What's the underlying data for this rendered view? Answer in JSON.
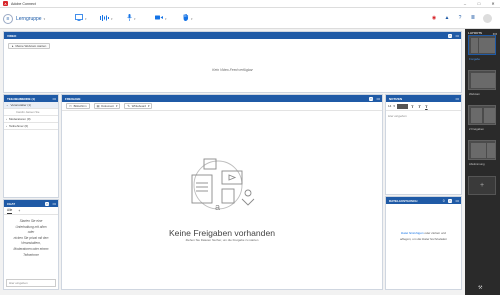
{
  "window": {
    "title": "Adobe Connect",
    "logo": "A"
  },
  "toolbar": {
    "room_name": "Lerngruppe",
    "share_icon": "share-screen-icon",
    "audio_icon": "audio-bars-icon",
    "mic_icon": "microphone-icon",
    "camera_icon": "camera-icon",
    "hand_icon": "raise-hand-icon"
  },
  "video": {
    "header": "VIDEO",
    "start_button": "Meine Webcam starten",
    "empty_text": "Kein Video-Feed verfügbar"
  },
  "participants": {
    "header": "TEILNEHMENDE (1)",
    "rows": [
      {
        "label": "Veranstalter (1)",
        "selected": true
      },
      {
        "label": "Carolin Jansen  Sie",
        "type": "name"
      },
      {
        "label": "Moderatoren (0)"
      },
      {
        "label": "Teilnehmer (0)"
      }
    ]
  },
  "share": {
    "header": "FREIGABE",
    "buttons": [
      "Bildschirm",
      "Dokument",
      "Whiteboard"
    ],
    "title": "Keine Freigaben vorhanden",
    "subtitle": "Ziehen Sie Dateien hierher, um die Freigabe zu starten"
  },
  "chat": {
    "header": "CHAT",
    "tabs": [
      "Alle",
      "+"
    ],
    "body_lines": [
      "Starten Sie eine",
      "Unterhaltung mit allen",
      "oder",
      "nicken Sie privat mit den",
      "Veranstaltern,",
      "Moderatoren oder einem",
      "Teilnehmer"
    ],
    "input_placeholder": "Hier eingeben"
  },
  "notes": {
    "header": "NOTIZEN",
    "font_size": "14",
    "placeholder": "Hier eingeben"
  },
  "files": {
    "header": "DATEI-AUSTAUSCH",
    "count": "0",
    "link_text": "Datei hinzufügen",
    "text_rest": " oder ziehen und",
    "line2": "ablegen, um die Datei hochzuladen"
  },
  "layouts": {
    "header": "LAYOUTS",
    "items": [
      {
        "label": "Freigabe",
        "active": true
      },
      {
        "label": "Webcam",
        "active": false
      },
      {
        "label": "2 Freigaben",
        "active": false
      },
      {
        "label": "Abstimmung",
        "active": false
      }
    ],
    "add_label": "+"
  },
  "colors": {
    "accent": "#1f5aa6",
    "brand": "#d7262b",
    "link": "#1473e6"
  }
}
